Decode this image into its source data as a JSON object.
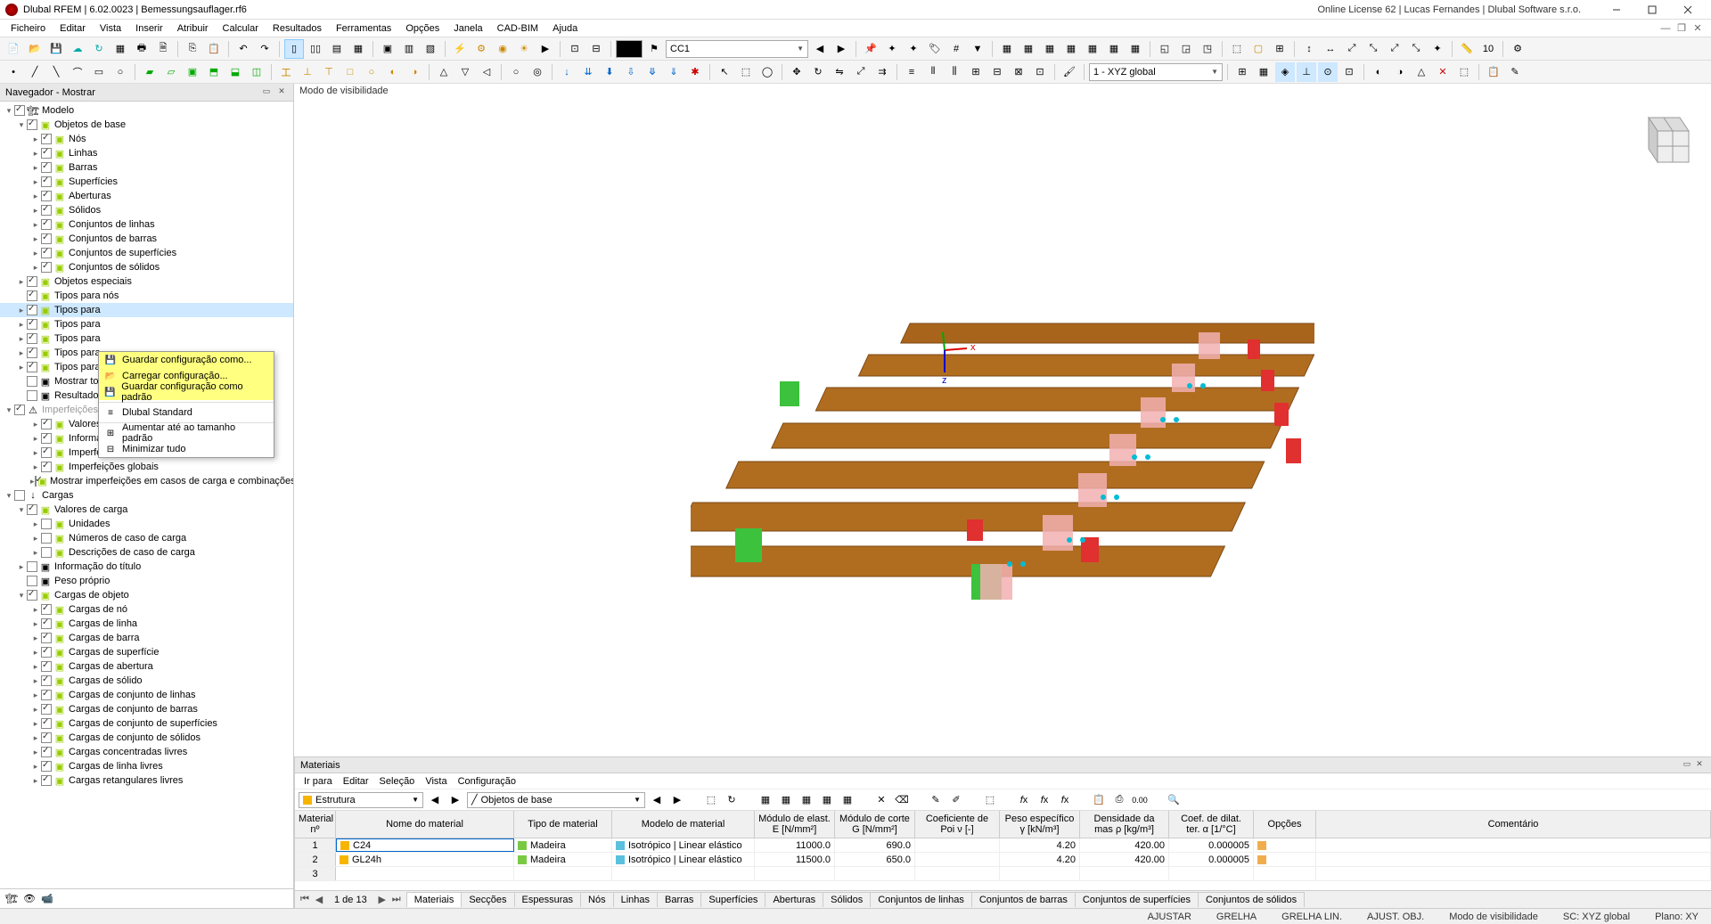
{
  "titlebar": {
    "title": "Dlubal RFEM | 6.02.0023 | Bemessungsauflager.rf6",
    "license": "Online License 62 | Lucas Fernandes | Dlubal Software s.r.o."
  },
  "menu": {
    "items": [
      "Ficheiro",
      "Editar",
      "Vista",
      "Inserir",
      "Atribuir",
      "Calcular",
      "Resultados",
      "Ferramentas",
      "Opções",
      "Janela",
      "CAD-BIM",
      "Ajuda"
    ]
  },
  "toolbar1": {
    "cc_label": "CC1"
  },
  "toolbar2": {
    "coord_label": "1 - XYZ global"
  },
  "navigator": {
    "title": "Navegador - Mostrar",
    "root": "Modelo",
    "base_objects": "Objetos de base",
    "base_items": [
      "Nós",
      "Linhas",
      "Barras",
      "Superfícies",
      "Aberturas",
      "Sólidos",
      "Conjuntos de linhas",
      "Conjuntos de barras",
      "Conjuntos de superfícies",
      "Conjuntos de sólidos"
    ],
    "special_objects": "Objetos especiais",
    "types_nodes": "Tipos para nós",
    "types_para": [
      "Tipos para",
      "Tipos para",
      "Tipos para",
      "Tipos para",
      "Tipos para"
    ],
    "show_topo": "Mostrar topol",
    "results_of": "Resultados de",
    "imperfections": "Imperfeições",
    "imperf_items": [
      "Valores de imperfeição",
      "Informação do título",
      "Imperfeições locais",
      "Imperfeições globais",
      "Mostrar imperfeições em casos de carga e combinações"
    ],
    "loads": "Cargas",
    "load_values": "Valores de carga",
    "load_value_items": [
      "Unidades",
      "Números de caso de carga",
      "Descrições de caso de carga"
    ],
    "title_info": "Informação do título",
    "self_weight": "Peso próprio",
    "object_loads": "Cargas de objeto",
    "object_load_items": [
      "Cargas de nó",
      "Cargas de linha",
      "Cargas de barra",
      "Cargas de superfície",
      "Cargas de abertura",
      "Cargas de sólido",
      "Cargas de conjunto de linhas",
      "Cargas de conjunto de barras",
      "Cargas de conjunto de superfícies",
      "Cargas de conjunto de sólidos",
      "Cargas concentradas livres",
      "Cargas de linha livres",
      "Cargas retangulares livres"
    ]
  },
  "context_menu": {
    "save_as": "Guardar configuração como...",
    "load": "Carregar configuração...",
    "save_default": "Guardar configuração como padrão",
    "dlubal_standard": "Dlubal Standard",
    "expand_default": "Aumentar até ao tamanho padrão",
    "minimize_all": "Minimizar tudo"
  },
  "viewport": {
    "mode_label": "Modo de visibilidade"
  },
  "panel": {
    "title": "Materiais",
    "menu": [
      "Ir para",
      "Editar",
      "Seleção",
      "Vista",
      "Configuração"
    ],
    "combo1": "Estrutura",
    "combo2": "Objetos de base",
    "cols": {
      "material_no": "Material\nnº",
      "material_name": "Nome do material",
      "material_type": "Tipo de\nmaterial",
      "material_model": "Modelo de material",
      "elastic_mod": "Módulo de elast.\nE [N/mm²]",
      "shear_mod": "Módulo de corte\nG [N/mm²]",
      "poisson": "Coeficiente de Poi\nν [-]",
      "spec_weight": "Peso específico\nγ [kN/m³]",
      "density": "Densidade da mas\nρ [kg/m³]",
      "thermal": "Coef. de dilat. ter.\nα [1/°C]",
      "options": "Opções",
      "comment": "Comentário"
    },
    "rows": [
      {
        "no": "1",
        "name": "C24",
        "type": "Madeira",
        "model": "Isotrópico | Linear elástico",
        "E": "11000.0",
        "G": "690.0",
        "nu": "",
        "gamma": "4.20",
        "rho": "420.00",
        "alpha": "0.000005"
      },
      {
        "no": "2",
        "name": "GL24h",
        "type": "Madeira",
        "model": "Isotrópico | Linear elástico",
        "E": "11500.0",
        "G": "650.0",
        "nu": "",
        "gamma": "4.20",
        "rho": "420.00",
        "alpha": "0.000005"
      },
      {
        "no": "3",
        "name": "",
        "type": "",
        "model": "",
        "E": "",
        "G": "",
        "nu": "",
        "gamma": "",
        "rho": "",
        "alpha": ""
      }
    ],
    "page_label": "1 de 13",
    "tabs": [
      "Materiais",
      "Secções",
      "Espessuras",
      "Nós",
      "Linhas",
      "Barras",
      "Superfícies",
      "Aberturas",
      "Sólidos",
      "Conjuntos de linhas",
      "Conjuntos de barras",
      "Conjuntos de superfícies",
      "Conjuntos de sólidos"
    ]
  },
  "statusbar": {
    "items": [
      "AJUSTAR",
      "GRELHA",
      "GRELHA LIN.",
      "AJUST. OBJ.",
      "Modo de visibilidade",
      "SC: XYZ global",
      "Plano: XY"
    ]
  }
}
